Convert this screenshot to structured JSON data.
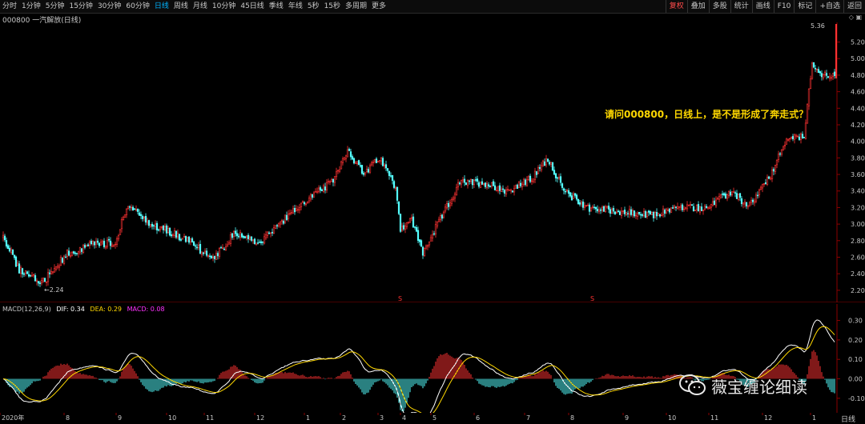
{
  "toolbar": {
    "left_tabs": [
      "分时",
      "1分钟",
      "5分钟",
      "15分钟",
      "30分钟",
      "60分钟",
      "日线",
      "周线",
      "月线",
      "10分钟",
      "45日线",
      "季线",
      "年线",
      "5秒",
      "15秒",
      "多周期",
      "更多"
    ],
    "active_tab": "日线",
    "right_tabs": [
      "复权",
      "叠加",
      "多股",
      "统计",
      "画线",
      "F10",
      "标记",
      "+自选",
      "返回"
    ],
    "active_right": "复权"
  },
  "stock_title": "000800 一汽解放(日线)",
  "question": "请问000800，日线上，是不是形成了奔走式？",
  "watermark": "薇宝缠论细读",
  "period_label": "日线",
  "colors": {
    "up": "#ff3232",
    "down": "#54ffff",
    "dif": "#ffffff",
    "dea": "#ffd800",
    "macd": "#ff32ff",
    "accent": "#00b4ff"
  },
  "macd_legend": {
    "title": "MACD(12,26,9)",
    "dif": "DIF: 0.34",
    "dea": "DEA: 0.29",
    "macd": "MACD: 0.08"
  },
  "chart_data": {
    "type": "candlestick",
    "price_axis": {
      "ylim": [
        2.16,
        5.36
      ],
      "ticks": [
        "5.20",
        "5.00",
        "4.80",
        "4.60",
        "4.40",
        "4.20",
        "4.00",
        "3.80",
        "3.60",
        "3.40",
        "3.20",
        "3.00",
        "2.80",
        "2.60",
        "2.40",
        "2.20"
      ]
    },
    "macd_axis": {
      "ylim": [
        -0.15,
        0.36
      ],
      "ticks": [
        "0.30",
        "0.20",
        "0.10",
        "0.00",
        "-0.10"
      ]
    },
    "annotations": {
      "high": "5.36",
      "low": "2.24",
      "marker": "S"
    },
    "x_ticks": [
      "2020年",
      "8",
      "9",
      "10",
      "11",
      "12",
      "1",
      "2",
      "3",
      "4",
      "5",
      "6",
      "7",
      "8",
      "9",
      "10",
      "11",
      "12",
      "1"
    ],
    "trend_keypoints": [
      [
        0,
        2.85
      ],
      [
        10,
        2.45
      ],
      [
        25,
        2.3
      ],
      [
        40,
        2.65
      ],
      [
        55,
        2.75
      ],
      [
        70,
        2.78
      ],
      [
        78,
        3.25
      ],
      [
        90,
        3.0
      ],
      [
        105,
        2.9
      ],
      [
        120,
        2.75
      ],
      [
        130,
        2.55
      ],
      [
        145,
        2.9
      ],
      [
        160,
        2.78
      ],
      [
        175,
        3.05
      ],
      [
        190,
        3.3
      ],
      [
        205,
        3.5
      ],
      [
        215,
        3.9
      ],
      [
        225,
        3.6
      ],
      [
        235,
        3.8
      ],
      [
        245,
        3.45
      ],
      [
        248,
        2.95
      ],
      [
        255,
        3.05
      ],
      [
        262,
        2.65
      ],
      [
        270,
        2.95
      ],
      [
        285,
        3.5
      ],
      [
        300,
        3.5
      ],
      [
        315,
        3.4
      ],
      [
        330,
        3.55
      ],
      [
        340,
        3.8
      ],
      [
        350,
        3.4
      ],
      [
        365,
        3.2
      ],
      [
        385,
        3.15
      ],
      [
        405,
        3.1
      ],
      [
        420,
        3.2
      ],
      [
        440,
        3.2
      ],
      [
        455,
        3.4
      ],
      [
        465,
        3.2
      ],
      [
        478,
        3.55
      ],
      [
        490,
        4.05
      ],
      [
        500,
        4.05
      ],
      [
        505,
        4.95
      ],
      [
        512,
        4.8
      ]
    ],
    "last": {
      "dif": 0.34,
      "dea": 0.29,
      "macd": 0.08
    }
  }
}
